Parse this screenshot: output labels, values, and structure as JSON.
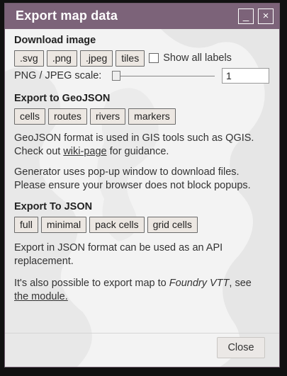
{
  "dialog": {
    "title": "Export map data",
    "minimize_label": "_",
    "close_label": "×"
  },
  "download_image": {
    "heading": "Download image",
    "buttons": [
      ".svg",
      ".png",
      ".jpeg",
      "tiles"
    ],
    "show_all_labels": "Show all labels",
    "show_all_labels_checked": false,
    "scale_label": "PNG / JPEG scale:",
    "scale_value": "1",
    "scale_slider_level": 0
  },
  "geojson": {
    "heading": "Export to GeoJSON",
    "buttons": [
      "cells",
      "routes",
      "rivers",
      "markers"
    ],
    "desc_line1": "GeoJSON format is used in GIS tools such as QGIS.",
    "desc_line2_prefix": "Check out ",
    "desc_link": "wiki-page",
    "desc_line2_suffix": " for guidance.",
    "popup_line1": "Generator uses pop-up window to download files.",
    "popup_line2": "Please ensure your browser does not block popups."
  },
  "json": {
    "heading": "Export To JSON",
    "buttons": [
      "full",
      "minimal",
      "pack cells",
      "grid cells"
    ],
    "desc_line1": "Export in JSON format can be used as an API",
    "desc_line2": "replacement.",
    "foundry_prefix": "It's also possible to export map to ",
    "foundry_name": "Foundry VTT",
    "foundry_suffix": ", see",
    "module_link": "the module."
  },
  "footer": {
    "close_button": "Close"
  }
}
